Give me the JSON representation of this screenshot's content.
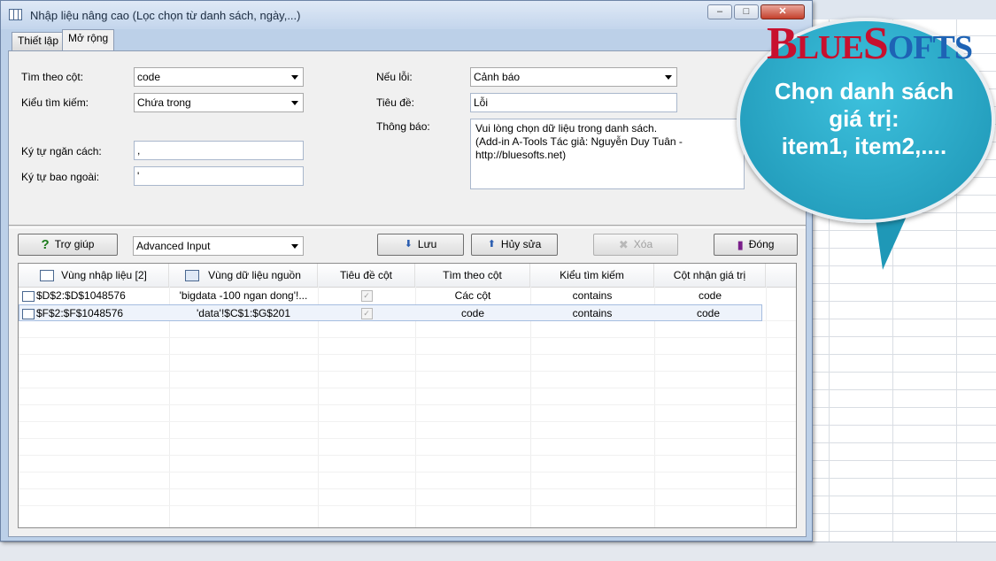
{
  "window": {
    "title": "Nhập liệu nâng cao (Lọc chọn từ danh sách, ngày,...)",
    "minimize": "–",
    "maximize": "□",
    "close": "✕"
  },
  "tabs": [
    {
      "label": "Thiết lập"
    },
    {
      "label": "Mở rộng"
    }
  ],
  "form_left": {
    "search_col_label": "Tìm theo cột:",
    "search_col_value": "code",
    "search_type_label": "Kiểu tìm kiếm:",
    "search_type_value": "Chứa trong",
    "separator_label": "Ký tự ngăn cách:",
    "separator_value": ",",
    "enclose_label": "Ký tự bao ngoài:",
    "enclose_value": "'"
  },
  "form_right": {
    "on_error_label": "Nếu lỗi:",
    "on_error_value": "Cảnh báo",
    "title_label": "Tiêu đề:",
    "title_value": "Lỗi",
    "message_label": "Thông báo:",
    "message_value": "Vui lòng chọn dữ liệu trong danh sách.\n(Add-in A-Tools Tác giả: Nguyễn Duy Tuân -\nhttp://bluesofts.net)"
  },
  "toolbar": {
    "help_label": "Trợ giúp",
    "mode_value": "Advanced Input",
    "save_label": "Lưu",
    "cancel_label": "Hủy sửa",
    "delete_label": "Xóa",
    "close_label": "Đóng"
  },
  "grid": {
    "headers": [
      "Vùng nhập liệu [2]",
      "Vùng dữ liệu nguồn",
      "Tiêu đề cột",
      "Tìm theo cột",
      "Kiểu tìm kiếm",
      "Cột nhận giá trị"
    ],
    "rows": [
      {
        "range": "$D$2:$D$1048576",
        "source": "'bigdata -100 ngan dong'!...",
        "header_checked": "✓",
        "search_col": "Các cột",
        "search_type": "contains",
        "value_col": "code"
      },
      {
        "range": "$F$2:$F$1048576",
        "source": "'data'!$C$1:$G$201",
        "header_checked": "✓",
        "search_col": "code",
        "search_type": "contains",
        "value_col": "code"
      }
    ]
  },
  "callout": {
    "logo_b": "B",
    "logo_lue": "LUE",
    "logo_s": "S",
    "logo_ofts": "OFTS",
    "line1": "Chọn danh sách",
    "line2": "giá trị:",
    "line3": "item1, item2,...."
  },
  "colors": {
    "dialog_frame": "#bcd0e8",
    "bubble": "#2aaccb",
    "logo_red": "#c8102e",
    "logo_blue": "#1e63b5"
  }
}
